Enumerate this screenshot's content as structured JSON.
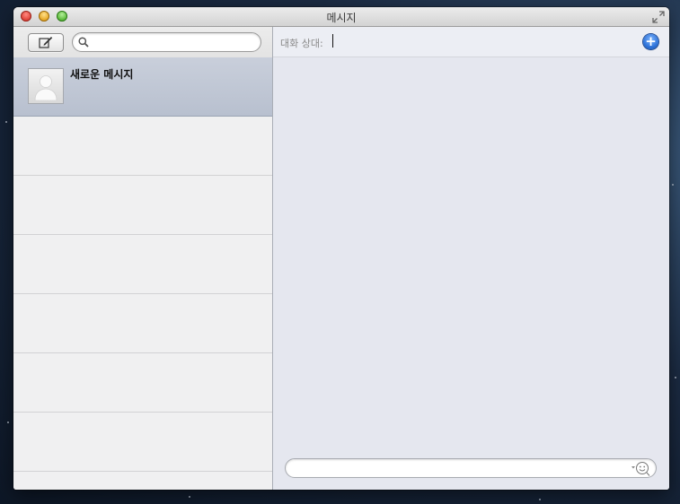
{
  "window": {
    "title": "메시지"
  },
  "sidebar": {
    "search": {
      "value": "",
      "placeholder": ""
    },
    "conversations": [
      {
        "name": "새로운 메시지",
        "selected": true
      }
    ]
  },
  "main": {
    "to_label": "대화 상대:",
    "to_value": "",
    "compose": {
      "value": "",
      "placeholder": ""
    }
  },
  "icons": {
    "compose": "compose-icon",
    "search": "search-icon",
    "add": "plus-circle-icon",
    "emoji": "smiley-icon",
    "fullscreen": "fullscreen-icon",
    "avatar": "person-placeholder-icon"
  },
  "colors": {
    "selected_row": "#bcc4d2",
    "add_button": "#2a6fd6",
    "close": "#e0443a",
    "minimize": "#e7a928",
    "zoom": "#5dbb3c"
  }
}
